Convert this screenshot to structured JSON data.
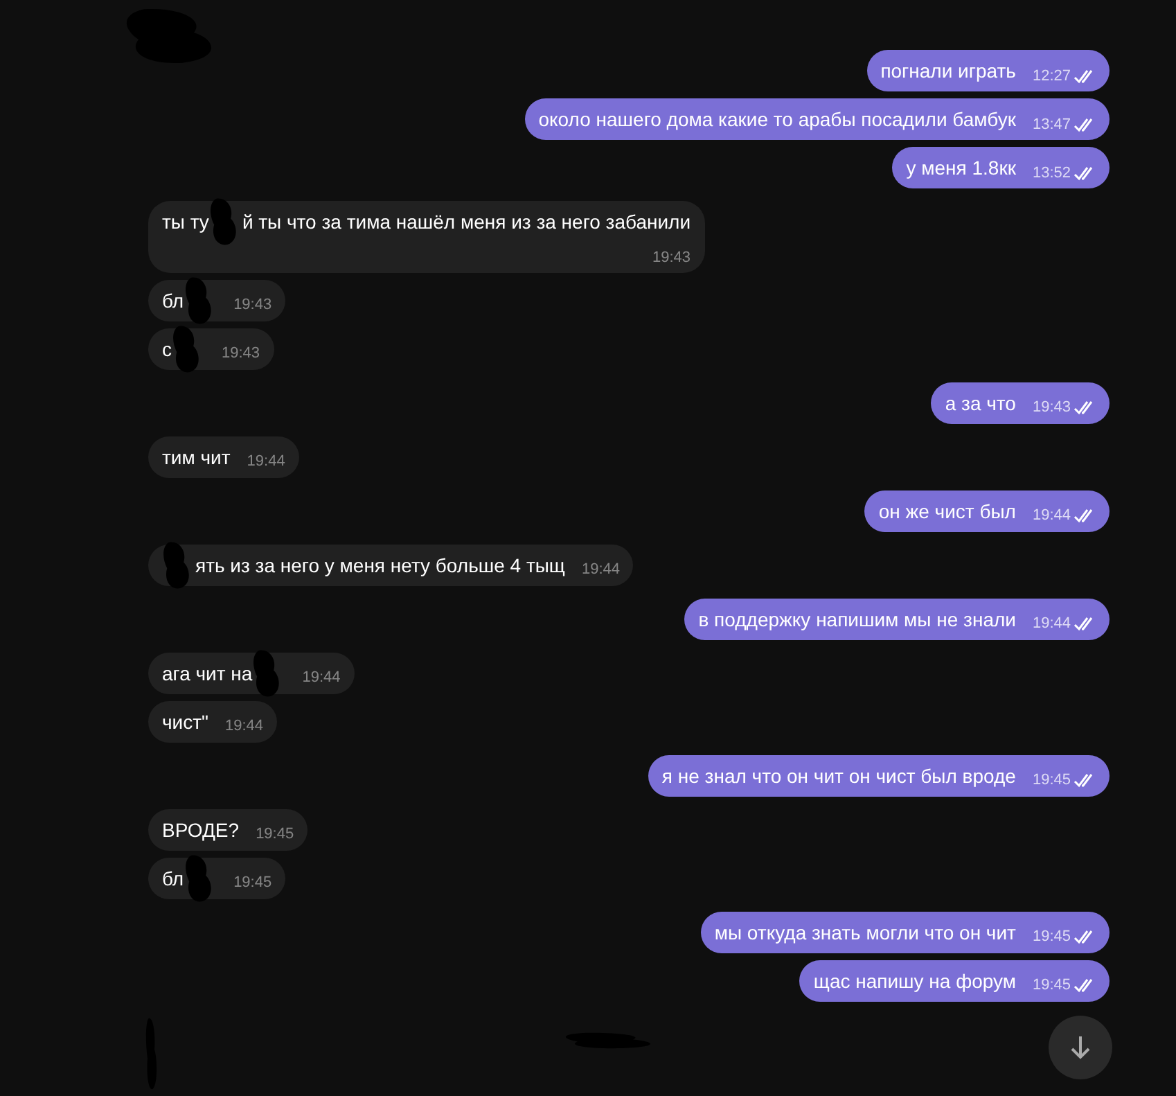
{
  "groups": [
    {
      "outgoing": true,
      "messages": [
        {
          "segments": [
            {
              "kind": "text",
              "text": "погнали играть"
            }
          ],
          "time": "12:27",
          "read": true
        },
        {
          "segments": [
            {
              "kind": "text",
              "text": "около нашего дома какие то арабы посадили бамбук"
            }
          ],
          "time": "13:47",
          "read": true
        },
        {
          "segments": [
            {
              "kind": "text",
              "text": "у меня 1.8кк"
            }
          ],
          "time": "13:52",
          "read": true
        }
      ]
    },
    {
      "outgoing": false,
      "messages": [
        {
          "segments": [
            {
              "kind": "text",
              "text": "ты ту"
            },
            {
              "kind": "redaction"
            },
            {
              "kind": "text",
              "text": "й ты что за тима нашёл меня из за него забанили"
            }
          ],
          "time": "19:43",
          "time_below": true
        },
        {
          "segments": [
            {
              "kind": "text",
              "text": "бл"
            },
            {
              "kind": "redaction"
            }
          ],
          "time": "19:43"
        },
        {
          "segments": [
            {
              "kind": "text",
              "text": "с"
            },
            {
              "kind": "redaction"
            }
          ],
          "time": "19:43"
        }
      ]
    },
    {
      "outgoing": true,
      "messages": [
        {
          "segments": [
            {
              "kind": "text",
              "text": "а за что"
            }
          ],
          "time": "19:43",
          "read": true
        }
      ]
    },
    {
      "outgoing": false,
      "messages": [
        {
          "segments": [
            {
              "kind": "text",
              "text": "тим чит"
            }
          ],
          "time": "19:44"
        }
      ]
    },
    {
      "outgoing": true,
      "messages": [
        {
          "segments": [
            {
              "kind": "text",
              "text": "он же чист был"
            }
          ],
          "time": "19:44",
          "read": true
        }
      ]
    },
    {
      "outgoing": false,
      "messages": [
        {
          "segments": [
            {
              "kind": "redaction"
            },
            {
              "kind": "text",
              "text": "ять из за него у меня нету больше 4 тыщ"
            }
          ],
          "time": "19:44"
        }
      ]
    },
    {
      "outgoing": true,
      "messages": [
        {
          "segments": [
            {
              "kind": "text",
              "text": "в поддержку напишим мы не знали"
            }
          ],
          "time": "19:44",
          "read": true
        }
      ]
    },
    {
      "outgoing": false,
      "messages": [
        {
          "segments": [
            {
              "kind": "text",
              "text": "ага чит на"
            },
            {
              "kind": "redaction"
            }
          ],
          "time": "19:44"
        },
        {
          "segments": [
            {
              "kind": "text",
              "text": "чист\""
            }
          ],
          "time": "19:44"
        }
      ]
    },
    {
      "outgoing": true,
      "messages": [
        {
          "segments": [
            {
              "kind": "text",
              "text": "я не знал что он чит он чист был вроде"
            }
          ],
          "time": "19:45",
          "read": true
        }
      ]
    },
    {
      "outgoing": false,
      "messages": [
        {
          "segments": [
            {
              "kind": "text",
              "text": "ВРОДЕ?"
            }
          ],
          "time": "19:45"
        },
        {
          "segments": [
            {
              "kind": "text",
              "text": "бл"
            },
            {
              "kind": "redaction"
            }
          ],
          "time": "19:45"
        }
      ]
    },
    {
      "outgoing": true,
      "messages": [
        {
          "segments": [
            {
              "kind": "text",
              "text": "мы откуда знать могли что он чит"
            }
          ],
          "time": "19:45",
          "read": true
        },
        {
          "segments": [
            {
              "kind": "text",
              "text": "щас напишу на форум"
            }
          ],
          "time": "19:45",
          "read": true
        }
      ]
    }
  ]
}
